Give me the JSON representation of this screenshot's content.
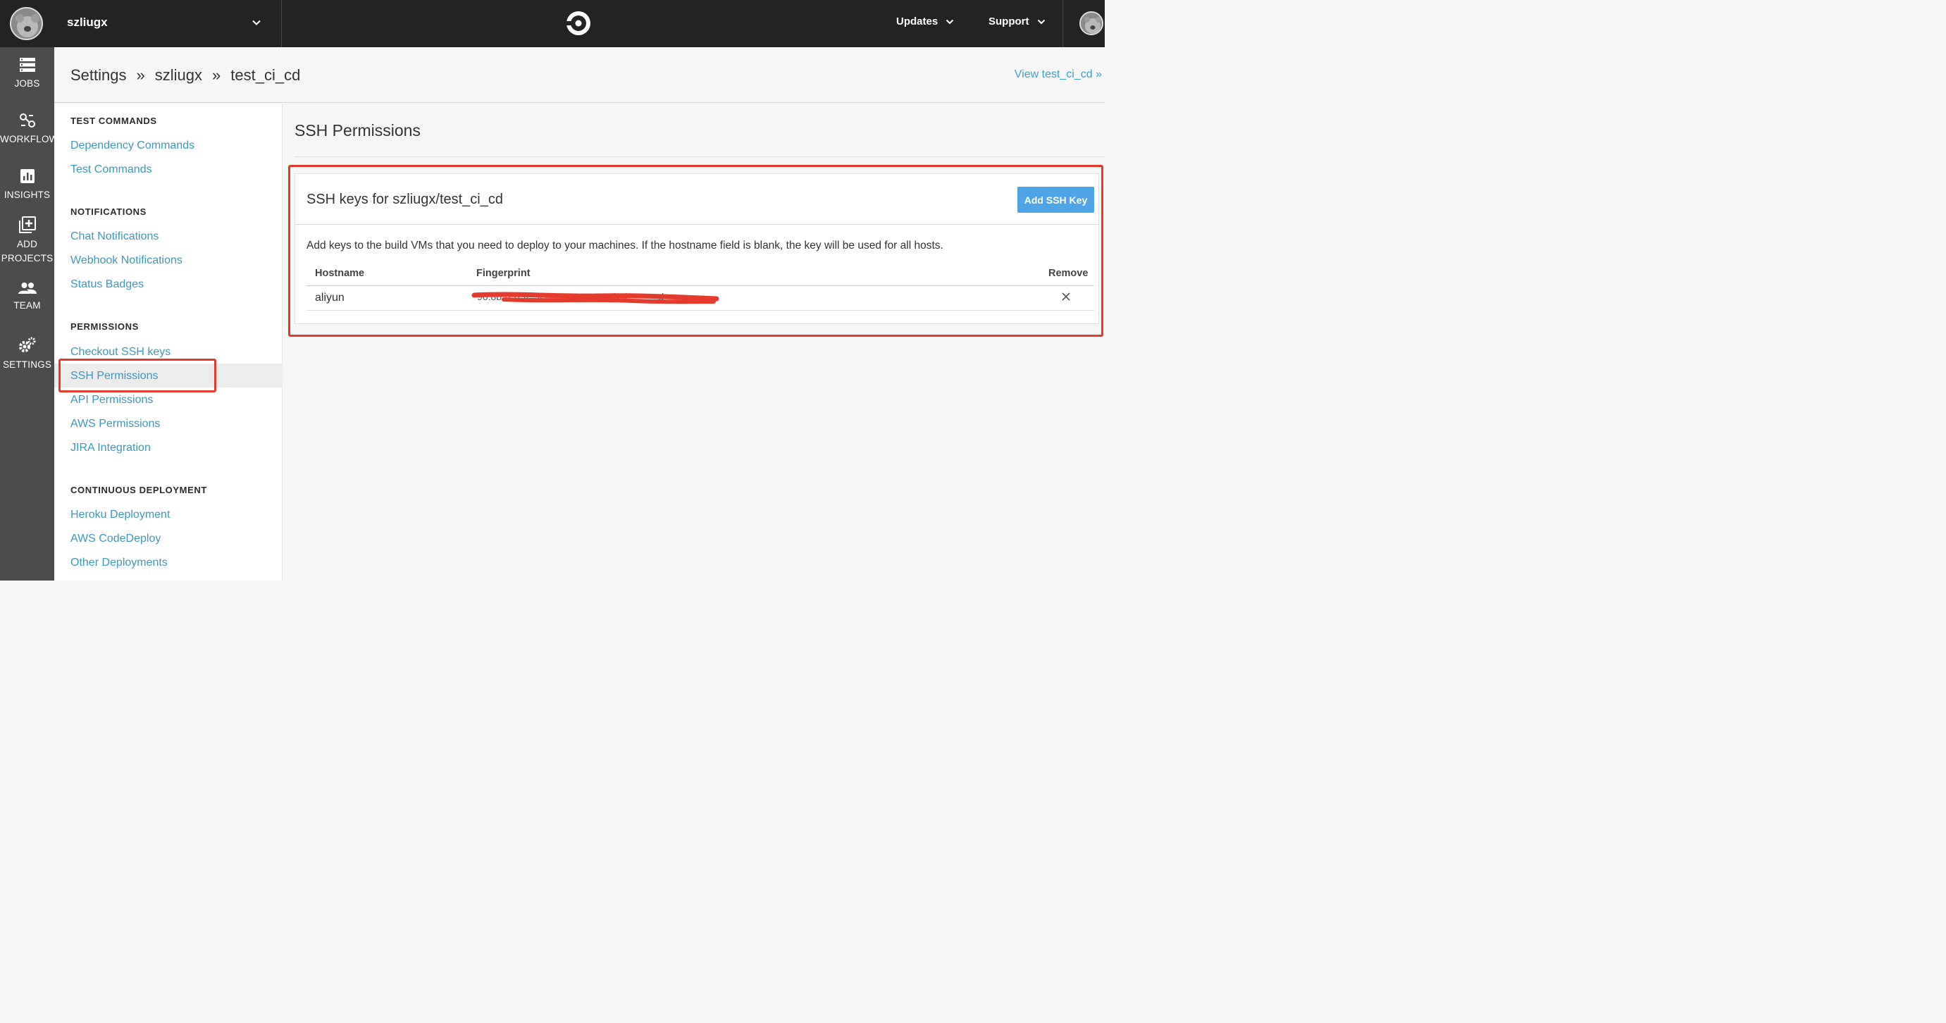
{
  "topbar": {
    "org_name": "szliugx",
    "menu": [
      {
        "label": "Updates"
      },
      {
        "label": "Support"
      }
    ]
  },
  "leftnav": {
    "items": [
      {
        "label": "JOBS",
        "icon": "jobs-icon"
      },
      {
        "label": "WORKFLOWS",
        "icon": "workflows-icon"
      },
      {
        "label": "INSIGHTS",
        "icon": "insights-icon"
      },
      {
        "label_line1": "ADD",
        "label_line2": "PROJECTS",
        "icon": "add-projects-icon"
      },
      {
        "label": "TEAM",
        "icon": "team-icon"
      },
      {
        "label": "SETTINGS",
        "icon": "settings-icon"
      }
    ]
  },
  "header": {
    "crumbs": [
      "Settings",
      "szliugx",
      "test_ci_cd"
    ],
    "separator": "»",
    "view_link": "View test_ci_cd »"
  },
  "sidebar": {
    "sections": [
      {
        "title": "TEST COMMANDS",
        "links": [
          "Dependency Commands",
          "Test Commands"
        ]
      },
      {
        "title": "NOTIFICATIONS",
        "links": [
          "Chat Notifications",
          "Webhook Notifications",
          "Status Badges"
        ]
      },
      {
        "title": "PERMISSIONS",
        "links": [
          "Checkout SSH keys",
          "SSH Permissions",
          "API Permissions",
          "AWS Permissions",
          "JIRA Integration"
        ]
      },
      {
        "title": "CONTINUOUS DEPLOYMENT",
        "links": [
          "Heroku Deployment",
          "AWS CodeDeploy",
          "Other Deployments"
        ]
      }
    ],
    "active": "SSH Permissions"
  },
  "main": {
    "title": "SSH Permissions",
    "card": {
      "title": "SSH keys for szliugx/test_ci_cd",
      "add_button": "Add SSH Key",
      "description": "Add keys to the build VMs that you need to deploy to your machines. If the hostname field is blank, the key will be used for all hosts.",
      "columns": [
        "Hostname",
        "Fingerprint",
        "Remove"
      ],
      "rows": [
        {
          "hostname": "aliyun",
          "fingerprint": "(redacted)"
        }
      ]
    }
  },
  "colors": {
    "topbar": "#232323",
    "leftnav": "#4c4c4c",
    "link": "#3c99bd",
    "button": "#4ea4e4",
    "annotation": "#e43b2c"
  }
}
